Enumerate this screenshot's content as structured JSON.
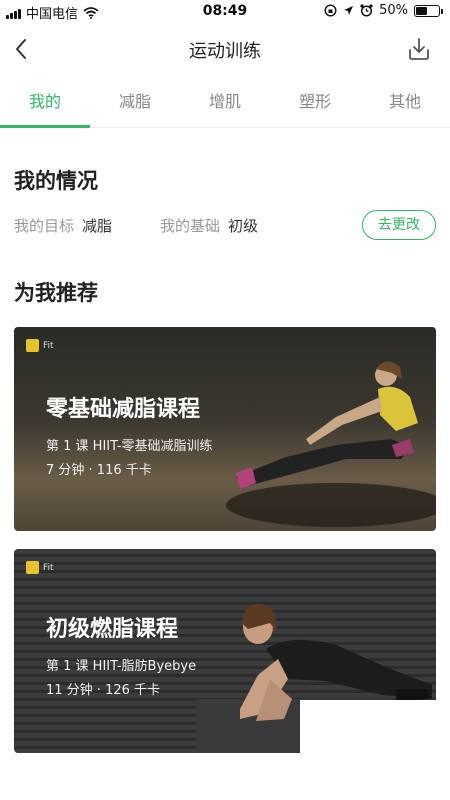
{
  "status_bar": {
    "carrier": "中国电信",
    "time": "08:49",
    "battery": "50%",
    "battery_level": 0.5
  },
  "nav": {
    "title": "运动训练"
  },
  "tabs": [
    {
      "label": "我的",
      "active": true
    },
    {
      "label": "减脂",
      "active": false
    },
    {
      "label": "增肌",
      "active": false
    },
    {
      "label": "塑形",
      "active": false
    },
    {
      "label": "其他",
      "active": false
    }
  ],
  "my_status": {
    "title": "我的情况",
    "goal_label": "我的目标",
    "goal_value": "减脂",
    "base_label": "我的基础",
    "base_value": "初级",
    "change_button": "去更改"
  },
  "recommend": {
    "title": "为我推荐",
    "courses": [
      {
        "logo": "Fit",
        "title": "零基础减脂课程",
        "lesson": "第 1 课 HIIT-零基础减脂训练",
        "meta": "7 分钟 · 116 千卡"
      },
      {
        "logo": "Fit",
        "title": "初级燃脂课程",
        "lesson": "第 1 课 HIIT-脂肪Byebye",
        "meta": "11 分钟 · 126 千卡"
      }
    ]
  },
  "colors": {
    "accent": "#2fba62"
  }
}
